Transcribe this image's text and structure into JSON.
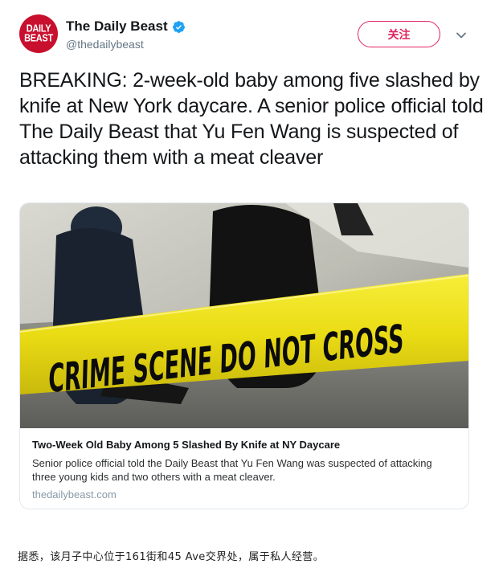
{
  "account": {
    "display_name": "The Daily Beast",
    "handle": "@thedailybeast",
    "avatar_text_line1": "DAILY",
    "avatar_text_line2": "BEAST",
    "verified": true
  },
  "follow_button": {
    "label": "关注"
  },
  "tweet": {
    "text": "BREAKING: 2-week-old baby among five slashed by knife at New York daycare. A senior police official told The Daily Beast that Yu Fen Wang is suspected of attacking them with a meat cleaver"
  },
  "card": {
    "image_tape_text": "CRIME SCENE DO NOT CROSS",
    "title": "Two-Week Old Baby Among 5 Slashed By Knife at NY Daycare",
    "description": "Senior police official told the Daily Beast that Yu Fen Wang was suspected of attacking three young kids and two others with a meat cleaver.",
    "domain": "thedailybeast.com"
  },
  "caption": "据悉，该月子中心位于161街和45 Ave交界处，属于私人经营。",
  "colors": {
    "brand_red": "#c8102e",
    "follow_accent": "#e0245e",
    "verified_blue": "#1da1f2",
    "secondary_text": "#657786",
    "tape_yellow": "#f2e51c"
  },
  "icons": {
    "verified": "verified-badge-icon",
    "caret": "chevron-down-icon"
  }
}
